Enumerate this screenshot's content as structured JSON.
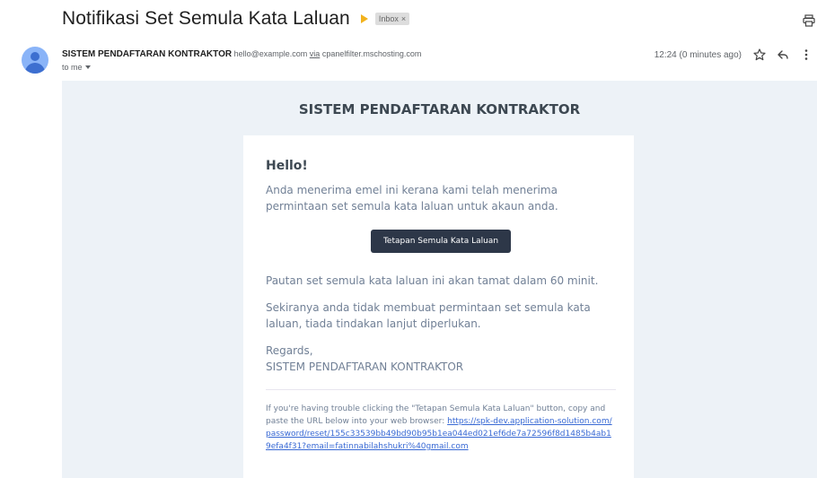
{
  "email": {
    "subject": "Notifikasi Set Semula Kata Laluan",
    "label": "Inbox",
    "label_close": "×",
    "sender_name": "SISTEM PENDAFTARAN KONTRAKTOR",
    "sender_email": "hello@example.com",
    "via_word": "via",
    "via_host": "cpanelfilter.mschosting.com",
    "to_line": "to me",
    "time": "12:24 (0 minutes ago)"
  },
  "body": {
    "header": "SISTEM PENDAFTARAN KONTRAKTOR",
    "greeting": "Hello!",
    "intro": "Anda menerima emel ini kerana kami telah menerima permintaan set semula kata laluan untuk akaun anda.",
    "button_label": "Tetapan Semula Kata Laluan",
    "expiry": "Pautan set semula kata laluan ini akan tamat dalam 60 minit.",
    "no_action": "Sekiranya anda tidak membuat permintaan set semula kata laluan, tiada tindakan lanjut diperlukan.",
    "regards": "Regards,",
    "signature": "SISTEM PENDAFTARAN KONTRAKTOR",
    "subcopy": "If you're having trouble clicking the \"Tetapan Semula Kata Laluan\" button, copy and paste the URL below into your web browser:",
    "reset_url": "https://spk-dev.application-solution.com/password/reset/155c33539bb49bd90b95b1ea044ed021ef6de7a72596f8d1485b4ab19efa4f31?email=fatinnabilahshukri%40gmail.com"
  },
  "icons": {
    "print": "print-icon",
    "star": "star-icon",
    "reply": "reply-icon",
    "more": "more-vert-icon",
    "avatar": "avatar"
  },
  "colors": {
    "importance": "#f2b21c",
    "email_bg": "#edf2f7",
    "button_bg": "#2d3748",
    "link": "#3869d4"
  }
}
